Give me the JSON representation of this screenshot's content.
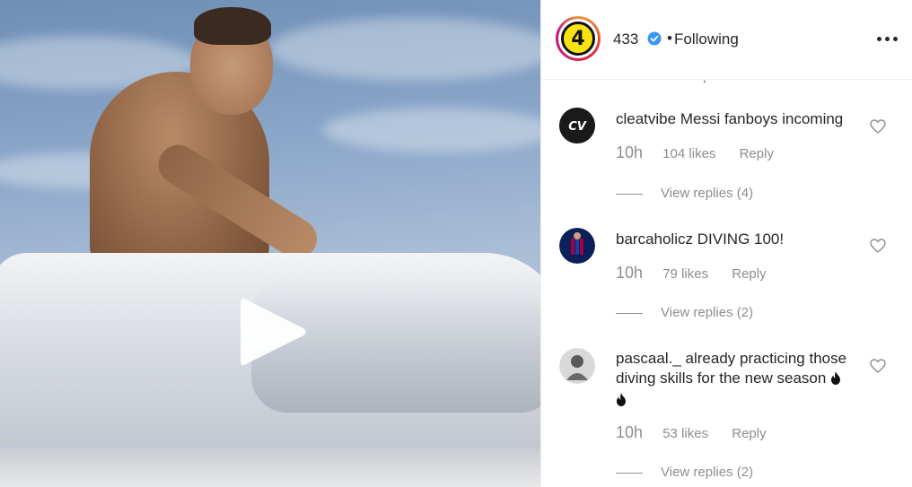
{
  "media": {
    "type": "video",
    "play_icon": "play-icon"
  },
  "header": {
    "avatar_text": "4",
    "username": "433",
    "verified_icon": "verified-badge-icon",
    "separator": "•",
    "follow_status": "Following",
    "more_icon": "more-options-icon"
  },
  "clipped_text": ",",
  "comments": [
    {
      "username": "cleatvibe",
      "text": "Messi fanboys incoming",
      "time": "10h",
      "likes": "104 likes",
      "reply_label": "Reply",
      "view_replies": "View replies (4)",
      "avatar_text": "CV"
    },
    {
      "username": "barcaholicz",
      "text": "DIVING 100!",
      "time": "10h",
      "likes": "79 likes",
      "reply_label": "Reply",
      "view_replies": "View replies (2)"
    },
    {
      "username": "pascaal._",
      "text": "already practicing those diving skills for the new season",
      "time": "10h",
      "likes": "53 likes",
      "reply_label": "Reply",
      "view_replies": "View replies (2)"
    }
  ],
  "colors": {
    "text": "#262626",
    "meta": "#8e8e8e",
    "verified": "#3897f0",
    "badge_yellow": "#fbe313"
  }
}
